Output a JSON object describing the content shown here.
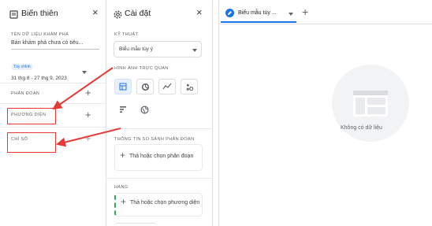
{
  "variables_panel": {
    "title": "Biến thiên",
    "close_label": "×",
    "data_exploration_label": "TÊN DỮ LIỆU KHÁM PHÁ",
    "data_exploration_value": "Bản khám phá chưa có tiêu...",
    "date_tag": "Tùy chỉnh",
    "date_range": "31 thg 8 - 27 thg 9, 2023",
    "segments_label": "PHÂN ĐOẠN",
    "dimensions_label": "PHƯƠNG DIỆN",
    "metrics_label": "CHỈ SỐ"
  },
  "settings_panel": {
    "title": "Cài đặt",
    "close_label": "×",
    "technique_label": "KỸ THUẬT",
    "technique_value": "Biểu mẫu tùy ý",
    "visualization_label": "HÌNH ẢNH TRỰC QUAN",
    "visualizations": [
      {
        "name": "table",
        "active": true
      },
      {
        "name": "donut",
        "active": false
      },
      {
        "name": "line",
        "active": false
      },
      {
        "name": "scatter",
        "active": false
      },
      {
        "name": "bar",
        "active": false
      },
      {
        "name": "geo",
        "active": false
      }
    ],
    "segment_comparison_label": "THÔNG TIN SO SÁNH PHÂN ĐOẠN",
    "segment_drop_text": "Thả hoặc chọn phân đoạn",
    "rows_label": "HÀNG",
    "rows_drop_text": "Thả hoặc chọn phương diện"
  },
  "tabs": {
    "active_tab_label": "Biểu mẫu tùy ...",
    "add_tab_label": "+"
  },
  "canvas": {
    "empty_text": "Không có dữ liệu"
  },
  "colors": {
    "accent": "#1a73e8",
    "annotation_arrow": "#e53935",
    "dashed_row": "#34a853"
  }
}
